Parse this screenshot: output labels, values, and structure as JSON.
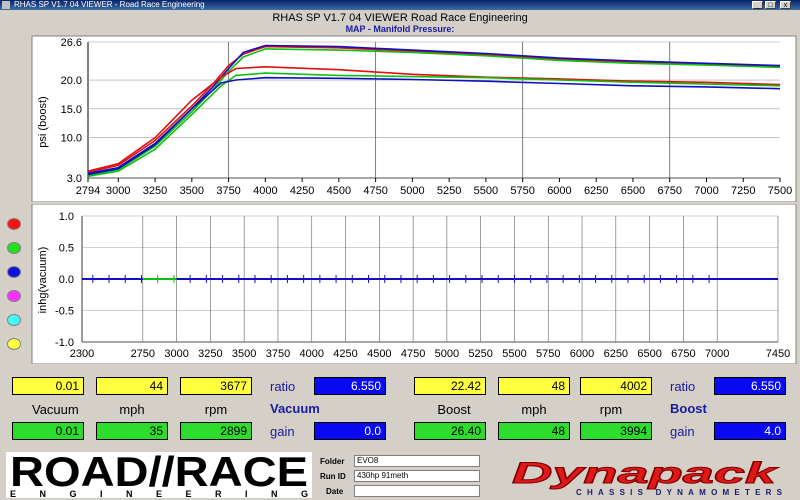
{
  "window": {
    "title": "RHAS SP V1.7 04 VIEWER - Road Race Engineering",
    "controls": [
      "_",
      "□",
      "x"
    ]
  },
  "header": {
    "title": "RHAS SP V1.7 04  VIEWER   Road Race Engineering",
    "subtitle": "MAP - Manifold Pressure:"
  },
  "chart_data": [
    {
      "type": "line",
      "title": "MAP - Manifold Pressure:",
      "ylabel": "psi (boost)",
      "xlabel": "",
      "xlim": [
        2794,
        7500
      ],
      "ylim": [
        3.0,
        26.6
      ],
      "y_ticks": [
        "26.6",
        "20.0",
        "15.0",
        "10.0",
        "3.0"
      ],
      "x_ticks": [
        "2794",
        "3000",
        "3250",
        "3500",
        "3750",
        "4000",
        "4250",
        "4500",
        "4750",
        "5000",
        "5250",
        "5500",
        "5750",
        "6000",
        "6250",
        "6500",
        "6750",
        "7000",
        "7250",
        "7500"
      ],
      "grid": true,
      "series": [
        {
          "color": "#e01010",
          "x": [
            2794,
            3000,
            3250,
            3500,
            3650,
            3750,
            3850,
            4000,
            4500,
            5000,
            5500,
            6000,
            6500,
            7000,
            7500
          ],
          "y": [
            4.0,
            5.2,
            9.5,
            15.5,
            19.5,
            22.5,
            24.5,
            25.8,
            25.6,
            25.0,
            24.4,
            23.6,
            23.1,
            22.8,
            22.4
          ]
        },
        {
          "color": "#10c010",
          "x": [
            2794,
            3000,
            3250,
            3500,
            3650,
            3750,
            3850,
            4000,
            4500,
            5000,
            5500,
            6000,
            6500,
            7000,
            7500
          ],
          "y": [
            3.5,
            4.5,
            8.5,
            14.5,
            18.5,
            21.5,
            24.0,
            25.4,
            25.2,
            24.8,
            24.2,
            23.4,
            22.9,
            22.6,
            22.2
          ]
        },
        {
          "color": "#1010c0",
          "x": [
            2794,
            3000,
            3250,
            3500,
            3650,
            3750,
            3850,
            4000,
            4500,
            5000,
            5500,
            6000,
            6500,
            7000,
            7500
          ],
          "y": [
            3.8,
            4.8,
            9.0,
            15.0,
            19.0,
            22.0,
            24.8,
            26.0,
            25.8,
            25.2,
            24.6,
            23.8,
            23.3,
            22.9,
            22.5
          ]
        },
        {
          "color": "#e01010",
          "x": [
            2794,
            3000,
            3250,
            3500,
            3700,
            3800,
            4000,
            4500,
            5000,
            5500,
            6000,
            6500,
            7000,
            7500
          ],
          "y": [
            4.2,
            5.5,
            10.0,
            16.5,
            20.5,
            22.0,
            22.3,
            21.8,
            21.0,
            20.5,
            20.2,
            19.8,
            19.6,
            19.2
          ]
        },
        {
          "color": "#10c010",
          "x": [
            2794,
            3000,
            3250,
            3500,
            3700,
            3800,
            4000,
            4500,
            5000,
            5500,
            6000,
            6500,
            7000,
            7500
          ],
          "y": [
            3.3,
            4.2,
            8.0,
            14.0,
            19.0,
            20.8,
            21.2,
            20.8,
            20.6,
            20.4,
            20.0,
            19.6,
            19.3,
            19.0
          ]
        },
        {
          "color": "#1010c0",
          "x": [
            2794,
            3000,
            3250,
            3500,
            3700,
            3800,
            4000,
            4500,
            5000,
            5500,
            6000,
            6500,
            7000,
            7500
          ],
          "y": [
            3.6,
            4.6,
            8.8,
            15.0,
            19.5,
            20.0,
            20.4,
            20.3,
            20.1,
            19.8,
            19.4,
            19.0,
            18.8,
            18.5
          ]
        }
      ]
    },
    {
      "type": "line",
      "title": "",
      "ylabel": "inhg(vacuum)",
      "xlabel": "",
      "xlim": [
        2300,
        7450
      ],
      "ylim": [
        -1.0,
        1.0
      ],
      "y_ticks": [
        "1.0",
        "0.5",
        "0.0",
        "-0.5",
        "-1.0"
      ],
      "x_ticks": [
        "2300",
        "2750",
        "3000",
        "3250",
        "3500",
        "3750",
        "4000",
        "4250",
        "4500",
        "4750",
        "5000",
        "5250",
        "5500",
        "5750",
        "6000",
        "6250",
        "6500",
        "6750",
        "7000",
        "7450"
      ],
      "grid": true,
      "series": [
        {
          "color": "#1010c0",
          "x": [
            2300,
            7450
          ],
          "y": [
            0.0,
            0.0
          ]
        },
        {
          "color": "#10c010",
          "x": [
            2750,
            3000
          ],
          "y": [
            0.0,
            0.0
          ]
        }
      ]
    }
  ],
  "legend_dots": [
    "#ff1010",
    "#20e020",
    "#1010e0",
    "#ff30ff",
    "#40ffff",
    "#ffff40"
  ],
  "readout_left": {
    "row1": [
      "0.01",
      "44",
      "3677"
    ],
    "labels": [
      "Vacuum",
      "mph",
      "rpm"
    ],
    "row2": [
      "0.01",
      "35",
      "2899"
    ],
    "ratio_label": "ratio",
    "ratio_value": "6.550",
    "heading": "Vacuum",
    "gain_label": "gain",
    "gain_value": "0.0"
  },
  "readout_right": {
    "row1": [
      "22.42",
      "48",
      "4002"
    ],
    "labels": [
      "Boost",
      "mph",
      "rpm"
    ],
    "row2": [
      "26.40",
      "48",
      "3994"
    ],
    "ratio_label": "ratio",
    "ratio_value": "6.550",
    "heading": "Boost",
    "gain_label": "gain",
    "gain_value": "4.0"
  },
  "footer": {
    "logo_left_main": "ROAD//RACE",
    "logo_left_sub": "ENGINEERING",
    "folder_label": "Folder",
    "folder_value": "EVO8",
    "runid_label": "Run ID",
    "runid_value": "430hp 91meth",
    "date_label": "Date",
    "date_value": "",
    "logo_right_main": "Dynapack",
    "logo_right_sub": "CHASSIS DYNAMOMETERS"
  }
}
